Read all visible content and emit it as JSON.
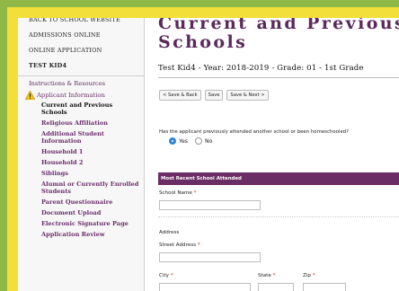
{
  "sidebar": {
    "top_links": [
      "BACK TO SCHOOL WEBSITE",
      "ADMISSIONS ONLINE",
      "ONLINE APPLICATION",
      "TEST KID4"
    ],
    "section_header": "Instructions & Resources",
    "warning_item": "Applicant Information",
    "sub_items": [
      "Current and Previous Schools",
      "Religious Affiliation",
      "Additional Student Information",
      "Household 1",
      "Household 2",
      "Siblings",
      "Alumni or Currently Enrolled Students",
      "Parent Questionnaire",
      "Document Upload",
      "Electronic Signature Page",
      "Application Review"
    ]
  },
  "main": {
    "title_line1": "Current and Previous",
    "title_line2": "Schools",
    "subtitle": "Test Kid4 - Year: 2018-2019 - Grade: 01 - 1st Grade",
    "buttons": {
      "save_back": "< Save & Back",
      "save": "Save",
      "save_next": "Save & Next >"
    },
    "question": "Has the applicant previously attended another school or been homeschooled?",
    "radio_yes": "Yes",
    "radio_no": "No",
    "section_title": "Most Recent School Attended",
    "school_name_label": "School Name",
    "address_heading": "Address",
    "street_label": "Street Address",
    "city_label": "City",
    "state_label": "State",
    "zip_label": "Zip",
    "required_mark": "*"
  },
  "colors": {
    "title": "#5a2a5a",
    "section_bar": "#6b2d66",
    "radio_selected": "#2f86d8",
    "frame": "#f2df3a",
    "background": "#8fb848"
  }
}
